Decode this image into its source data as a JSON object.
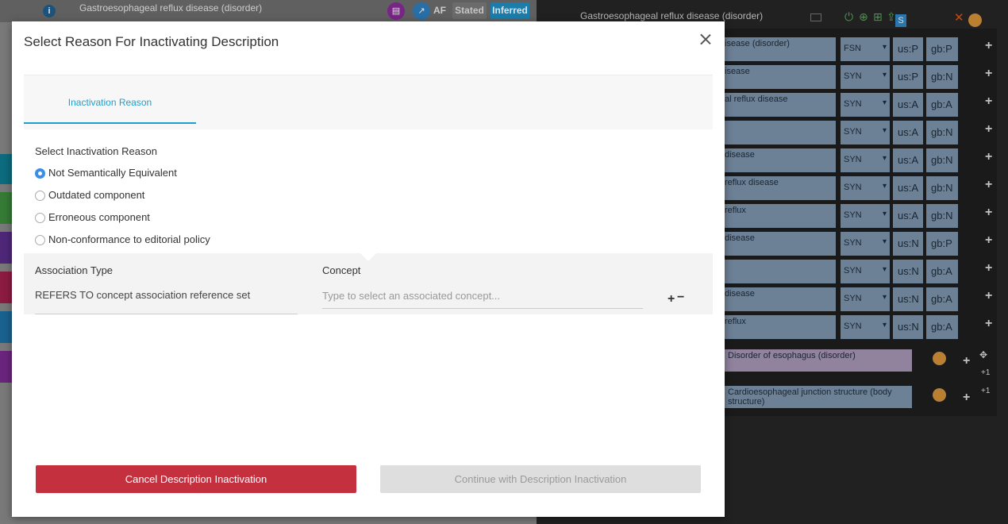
{
  "background": {
    "left_title": "Gastroesophageal reflux disease (disorder)",
    "right_title": "Gastroesophageal reflux disease (disorder)",
    "badges": {
      "af": "AF",
      "stated": "Stated",
      "inferred": "Inferred"
    },
    "descriptions": [
      {
        "term": "isease (disorder)",
        "type": "FSN",
        "us": "us:P",
        "gb": "gb:P"
      },
      {
        "term": "isease",
        "type": "SYN",
        "us": "us:P",
        "gb": "gb:N"
      },
      {
        "term": "al reflux disease",
        "type": "SYN",
        "us": "us:A",
        "gb": "gb:A"
      },
      {
        "term": "",
        "type": "SYN",
        "us": "us:A",
        "gb": "gb:N"
      },
      {
        "term": "disease",
        "type": "SYN",
        "us": "us:A",
        "gb": "gb:N"
      },
      {
        "term": "reflux disease",
        "type": "SYN",
        "us": "us:A",
        "gb": "gb:N"
      },
      {
        "term": "reflux",
        "type": "SYN",
        "us": "us:A",
        "gb": "gb:N"
      },
      {
        "term": "disease",
        "type": "SYN",
        "us": "us:N",
        "gb": "gb:P"
      },
      {
        "term": "",
        "type": "SYN",
        "us": "us:N",
        "gb": "gb:A"
      },
      {
        "term": "disease",
        "type": "SYN",
        "us": "us:N",
        "gb": "gb:A"
      },
      {
        "term": "reflux",
        "type": "SYN",
        "us": "us:N",
        "gb": "gb:A"
      }
    ],
    "parent": "Disorder of esophagus (disorder)",
    "finding_site": "Cardioesophageal junction structure (body structure)",
    "plus_one": "+1",
    "colors": {
      "teal": "#0e7a8f",
      "green": "#3d8b3d",
      "purple": "#5b2d8a",
      "crimson": "#a01f4a",
      "blue": "#1d6fa3",
      "violet": "#7a2a8f"
    }
  },
  "modal": {
    "title": "Select Reason For Inactivating Description",
    "tab_label": "Inactivation Reason",
    "reason_label": "Select Inactivation Reason",
    "reasons": [
      {
        "label": "Not Semantically Equivalent",
        "checked": true
      },
      {
        "label": "Outdated component",
        "checked": false
      },
      {
        "label": "Erroneous component",
        "checked": false
      },
      {
        "label": "Non-conformance to editorial policy",
        "checked": false
      }
    ],
    "association_type_label": "Association Type",
    "association_type_value": "REFERS TO concept association reference set",
    "concept_label": "Concept",
    "concept_placeholder": "Type to select an associated concept...",
    "add_symbol": "+",
    "remove_symbol": "−",
    "cancel_label": "Cancel Description Inactivation",
    "continue_label": "Continue with Description Inactivation",
    "accent": "#1e9fcb",
    "danger": "#c4303e"
  }
}
